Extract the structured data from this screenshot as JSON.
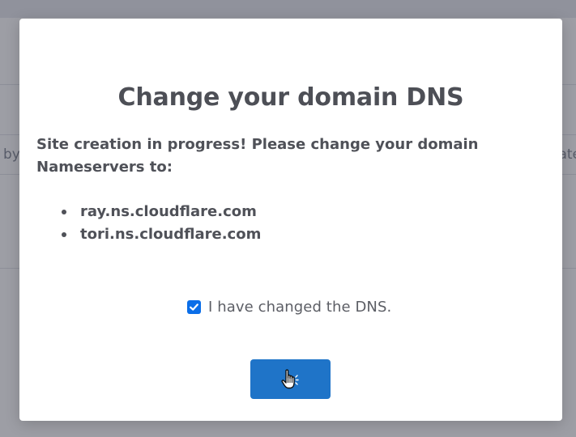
{
  "background": {
    "left_fragment": "by",
    "right_fragment": "ate"
  },
  "modal": {
    "title": "Change your domain DNS",
    "message": "Site creation in progress! Please change your domain Nameservers to:",
    "nameservers": [
      "ray.ns.cloudflare.com",
      "tori.ns.cloudflare.com"
    ],
    "confirm": {
      "label": "I have changed the DNS.",
      "checked": true
    },
    "button": {
      "label": "",
      "icon": "hand-pointer-cursor-icon"
    }
  },
  "colors": {
    "accent": "#1f74c8",
    "checkbox": "#0b6ee8",
    "title_text": "#4d4f56",
    "overlay": "#16182a"
  }
}
